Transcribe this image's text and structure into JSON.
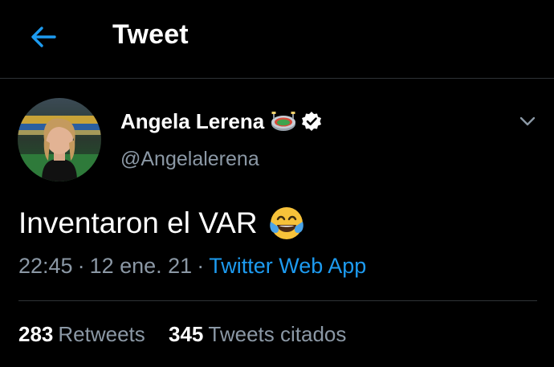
{
  "header": {
    "title": "Tweet",
    "back_icon": "arrow-left-icon"
  },
  "author": {
    "display_name": "Angela Lerena",
    "handle": "@Angelalerena",
    "badges": [
      "stadium-icon",
      "verified-icon"
    ]
  },
  "tweet": {
    "text": "Inventaron el VAR",
    "emoji": "face-with-tears-of-joy-icon",
    "time": "22:45",
    "date": "12 ene. 21",
    "separator": "·",
    "source": "Twitter Web App"
  },
  "stats": {
    "retweets_count": "283",
    "retweets_label": "Retweets",
    "quotes_count": "345",
    "quotes_label": "Tweets citados"
  },
  "colors": {
    "background": "#000000",
    "text": "#ffffff",
    "secondary_text": "#8b98a5",
    "accent": "#1d9bf0",
    "divider": "#2f3336"
  }
}
